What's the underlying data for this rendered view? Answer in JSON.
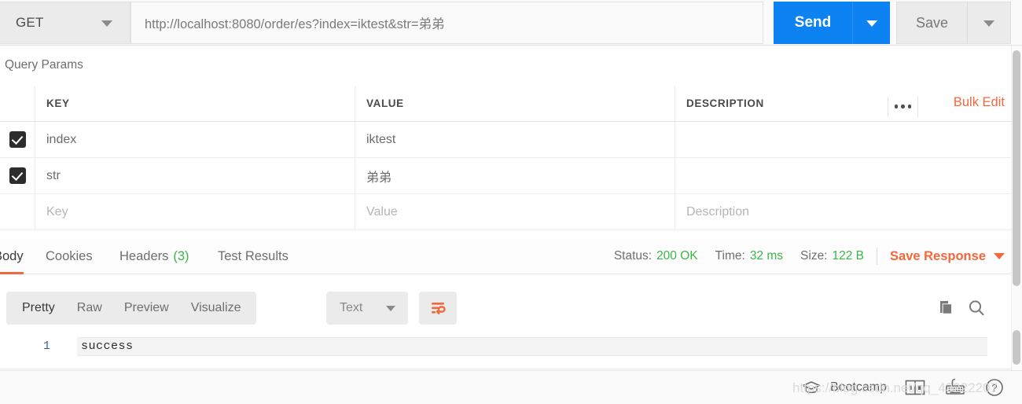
{
  "request": {
    "method": "GET",
    "url": "http://localhost:8080/order/es?index=iktest&str=弟弟",
    "send_label": "Send",
    "save_label": "Save"
  },
  "query_params": {
    "section_title": "Query Params",
    "headers": {
      "key": "KEY",
      "value": "VALUE",
      "description": "DESCRIPTION"
    },
    "bulk_edit_label": "Bulk Edit",
    "rows": [
      {
        "checked": true,
        "key": "index",
        "value": "iktest",
        "description": ""
      },
      {
        "checked": true,
        "key": "str",
        "value": "弟弟",
        "description": ""
      }
    ],
    "placeholder_row": {
      "key": "Key",
      "value": "Value",
      "description": "Description"
    }
  },
  "response": {
    "tabs": [
      {
        "label": "Body",
        "active": true
      },
      {
        "label": "Cookies",
        "active": false
      },
      {
        "label": "Headers",
        "count": "(3)",
        "active": false
      },
      {
        "label": "Test Results",
        "active": false
      }
    ],
    "status": {
      "status_label": "Status:",
      "status_value": "200 OK",
      "time_label": "Time:",
      "time_value": "32 ms",
      "size_label": "Size:",
      "size_value": "122 B"
    },
    "save_response_label": "Save Response",
    "format_tabs": [
      {
        "label": "Pretty",
        "active": true
      },
      {
        "label": "Raw",
        "active": false
      },
      {
        "label": "Preview",
        "active": false
      },
      {
        "label": "Visualize",
        "active": false
      }
    ],
    "content_type": "Text",
    "body": {
      "line_number": "1",
      "line_text": "success"
    }
  },
  "bottom_bar": {
    "bootcamp_label": "Bootcamp"
  },
  "watermark": {
    "text": "https://blog.csdn.net/qq_43222207"
  },
  "colors": {
    "accent_orange": "#f2683c",
    "send_blue": "#0d82f2",
    "status_green": "#3ab549",
    "checkbox_dark": "#2c2c2c"
  }
}
